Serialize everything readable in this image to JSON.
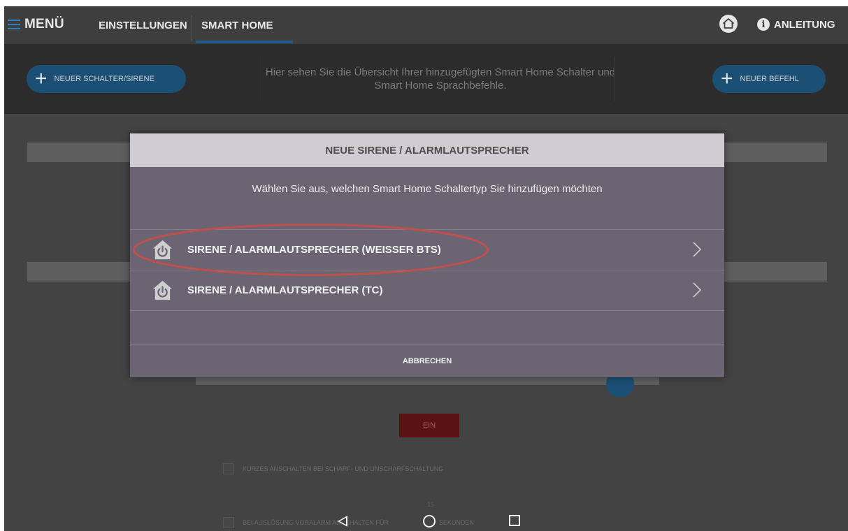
{
  "topbar": {
    "menu_label": "MENÜ",
    "tabs": [
      {
        "label": "EINSTELLUNGEN"
      },
      {
        "label": "SMART HOME"
      }
    ],
    "help_label": "ANLEITUNG"
  },
  "header": {
    "left_button": "NEUER SCHALTER/SIRENE",
    "description": "Hier sehen Sie die Übersicht Ihrer hinzugefügten Smart Home Schalter und Smart Home Sprachbefehle.",
    "right_button": "NEUER BEFEHL"
  },
  "background": {
    "ein_button": "EIN",
    "checkbox1_label": "KURZES ANSCHALTEN BEI SCHARF- UND UNSCHARFSCHALTUNG",
    "checkbox2_label": "BEI AUSLÖSUNG VORALARM ANSCHALTEN FÜR",
    "seconds_value": "15",
    "seconds_label": "SEKUNDEN"
  },
  "dialog": {
    "title": "NEUE SIRENE / ALARMLAUTSPRECHER",
    "subtitle": "Wählen Sie aus, welchen Smart Home Schaltertyp Sie hinzufügen möchten",
    "options": [
      {
        "label": "SIRENE / ALARMLAUTSPRECHER (WEISSER BTS)",
        "icon": "smart-home-power-icon"
      },
      {
        "label": "SIRENE / ALARMLAUTSPRECHER (TC)",
        "icon": "smart-home-power-icon"
      }
    ],
    "cancel_label": "ABBRECHEN"
  },
  "colors": {
    "accent_blue": "#1c4f74",
    "dialog_bg": "#6b6472",
    "highlight_ring": "#c0504d"
  }
}
